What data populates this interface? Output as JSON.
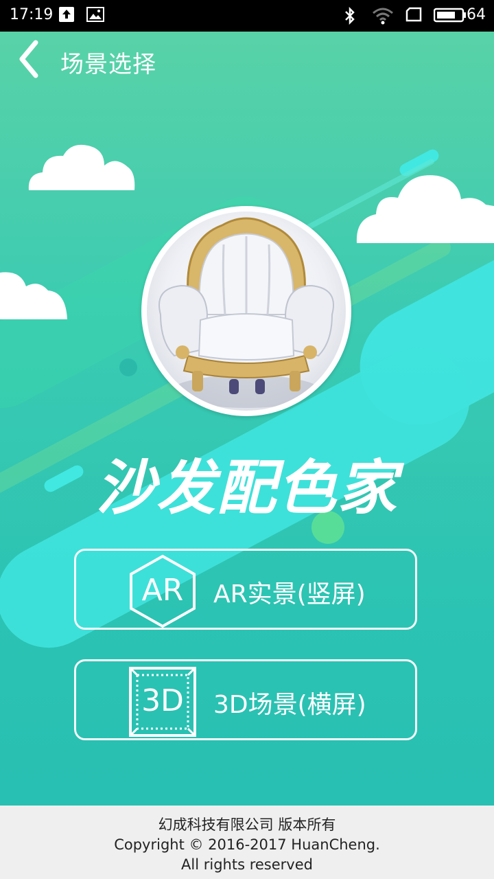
{
  "status_bar": {
    "time": "17:19",
    "battery": "64",
    "icons": [
      "upload-icon",
      "image-icon",
      "bluetooth-icon",
      "wifi-icon",
      "sim-icon",
      "battery-icon"
    ]
  },
  "header": {
    "title": "场景选择",
    "back_icon": "chevron-left-icon"
  },
  "brand": {
    "name": "沙发配色家"
  },
  "modes": [
    {
      "icon_text": "AR",
      "label": "AR实景(竖屏)"
    },
    {
      "icon_text": "3D",
      "label": "3D场景(横屏)"
    }
  ],
  "footer": {
    "line1": "幻成科技有限公司 版本所有",
    "line2": "Copyright © 2016-2017 HuanCheng.",
    "line3": "All rights reserved"
  },
  "colors": {
    "bg_top": "#5cd3a6",
    "bg_bottom": "#27beb2",
    "accent_cyan": "#3ee6e0",
    "footer_bg": "#efefef"
  }
}
